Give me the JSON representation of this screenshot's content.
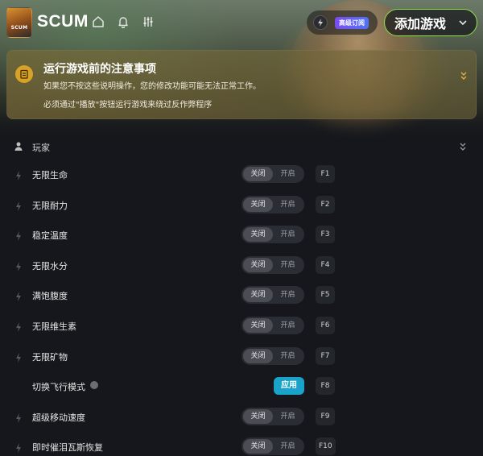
{
  "header": {
    "logo_text": "SCUM",
    "title": "SCUM",
    "icons": [
      "home-icon",
      "bell-icon",
      "sliders-icon"
    ],
    "subscription_badge": "高级订阅",
    "add_game_label": "添加游戏"
  },
  "notice": {
    "title": "运行游戏前的注意事项",
    "line1": "如果您不按这些说明操作，您的修改功能可能无法正常工作。",
    "line2": "必须通过\"播放\"按钮运行游戏来绕过反作弊程序"
  },
  "section": {
    "label": "玩家"
  },
  "toggle_labels": {
    "off": "关闭",
    "on": "开启"
  },
  "apply_label": "应用",
  "cheats": [
    {
      "name": "无限生命",
      "type": "toggle",
      "state": "off",
      "hotkey": "F1"
    },
    {
      "name": "无限耐力",
      "type": "toggle",
      "state": "off",
      "hotkey": "F2"
    },
    {
      "name": "稳定温度",
      "type": "toggle",
      "state": "off",
      "hotkey": "F3"
    },
    {
      "name": "无限水分",
      "type": "toggle",
      "state": "off",
      "hotkey": "F4"
    },
    {
      "name": "满饱腹度",
      "type": "toggle",
      "state": "off",
      "hotkey": "F5"
    },
    {
      "name": "无限维生素",
      "type": "toggle",
      "state": "off",
      "hotkey": "F6"
    },
    {
      "name": "无限矿物",
      "type": "toggle",
      "state": "off",
      "hotkey": "F7"
    },
    {
      "name": "切换飞行模式",
      "type": "apply",
      "hotkey": "F8"
    },
    {
      "name": "超级移动速度",
      "type": "toggle",
      "state": "off",
      "hotkey": "F9"
    },
    {
      "name": "即时催泪瓦斯恢复",
      "type": "toggle",
      "state": "off",
      "hotkey": "F10"
    }
  ],
  "colors": {
    "accent_green": "#8ee24a",
    "apply_blue": "#1aa3c8",
    "notice_icon": "#d9a227"
  }
}
